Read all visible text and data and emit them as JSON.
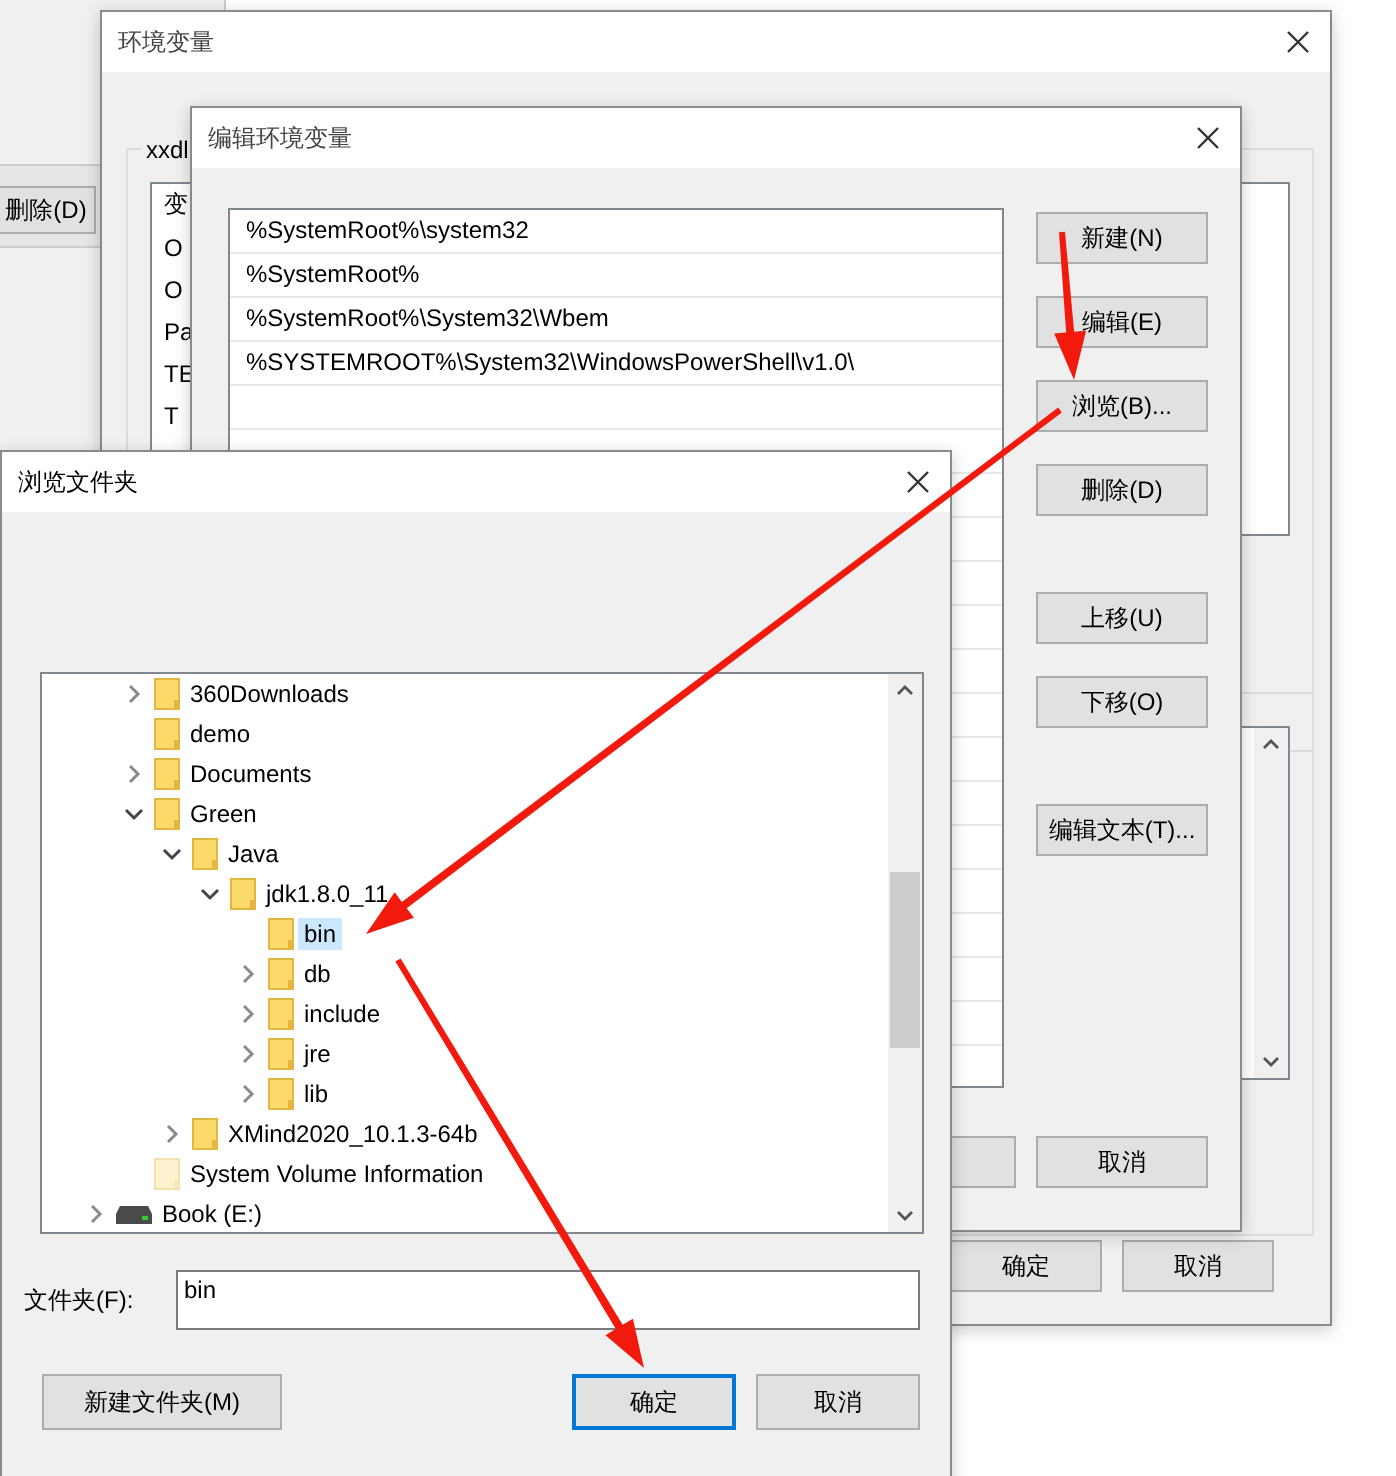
{
  "background_window": {
    "button": "删除(D)"
  },
  "env_window": {
    "title": "环境变量",
    "group_label": "xxdl",
    "list": {
      "header": "变",
      "rows": [
        "O",
        "O",
        "Pa",
        "TE",
        "T"
      ]
    },
    "buttons": [
      "确定",
      "取消"
    ]
  },
  "edit_window": {
    "title": "编辑环境变量",
    "entries": [
      {
        "text": "%SystemRoot%\\system32",
        "selected": false
      },
      {
        "text": "%SystemRoot%",
        "selected": false
      },
      {
        "text": "%SystemRoot%\\System32\\Wbem",
        "selected": false
      },
      {
        "text": "%SYSTEMROOT%\\System32\\WindowsPowerShell\\v1.0\\",
        "selected": false
      }
    ],
    "button_groups": [
      [
        "新建(N)",
        "编辑(E)",
        "浏览(B)...",
        "删除(D)"
      ],
      [
        "上移(U)",
        "下移(O)"
      ],
      [
        "编辑文本(T)..."
      ]
    ],
    "bottom_buttons": [
      "取消"
    ]
  },
  "browse_dialog": {
    "title": "浏览文件夹",
    "tree": {
      "scrolled_children": [
        {
          "label": "360Downloads",
          "kind": "folder",
          "expandable": true,
          "expanded": false,
          "selected": false
        },
        {
          "label": "demo",
          "kind": "folder",
          "expandable": false,
          "expanded": false,
          "selected": false
        },
        {
          "label": "Documents",
          "kind": "folder",
          "expandable": true,
          "expanded": false,
          "selected": false
        },
        {
          "label": "Green",
          "kind": "folder",
          "expandable": true,
          "expanded": true,
          "selected": false,
          "children": [
            {
              "label": "Java",
              "kind": "folder",
              "expandable": true,
              "expanded": true,
              "selected": false,
              "children": [
                {
                  "label": "jdk1.8.0_11",
                  "kind": "folder",
                  "expandable": true,
                  "expanded": true,
                  "selected": false,
                  "children": [
                    {
                      "label": "bin",
                      "kind": "folder",
                      "expandable": false,
                      "expanded": false,
                      "selected": true
                    },
                    {
                      "label": "db",
                      "kind": "folder",
                      "expandable": true,
                      "expanded": false,
                      "selected": false
                    },
                    {
                      "label": "include",
                      "kind": "folder",
                      "expandable": true,
                      "expanded": false,
                      "selected": false
                    },
                    {
                      "label": "jre",
                      "kind": "folder",
                      "expandable": true,
                      "expanded": false,
                      "selected": false
                    },
                    {
                      "label": "lib",
                      "kind": "folder",
                      "expandable": true,
                      "expanded": false,
                      "selected": false
                    }
                  ]
                }
              ]
            },
            {
              "label": "XMind2020_10.1.3-64b",
              "kind": "folder",
              "expandable": true,
              "expanded": false,
              "selected": false
            }
          ]
        },
        {
          "label": "System Volume Information",
          "kind": "hidden_folder",
          "expandable": false,
          "expanded": false,
          "selected": false
        }
      ],
      "roots": [
        {
          "label": "Book (E:)",
          "kind": "drive",
          "expandable": true,
          "expanded": false,
          "selected": false
        }
      ]
    },
    "folder_label": "文件夹(F):",
    "folder_value": "bin",
    "buttons": [
      {
        "label": "新建文件夹(M)",
        "focused": false
      },
      {
        "label": "确定",
        "focused": true
      },
      {
        "label": "取消",
        "focused": false
      }
    ]
  }
}
